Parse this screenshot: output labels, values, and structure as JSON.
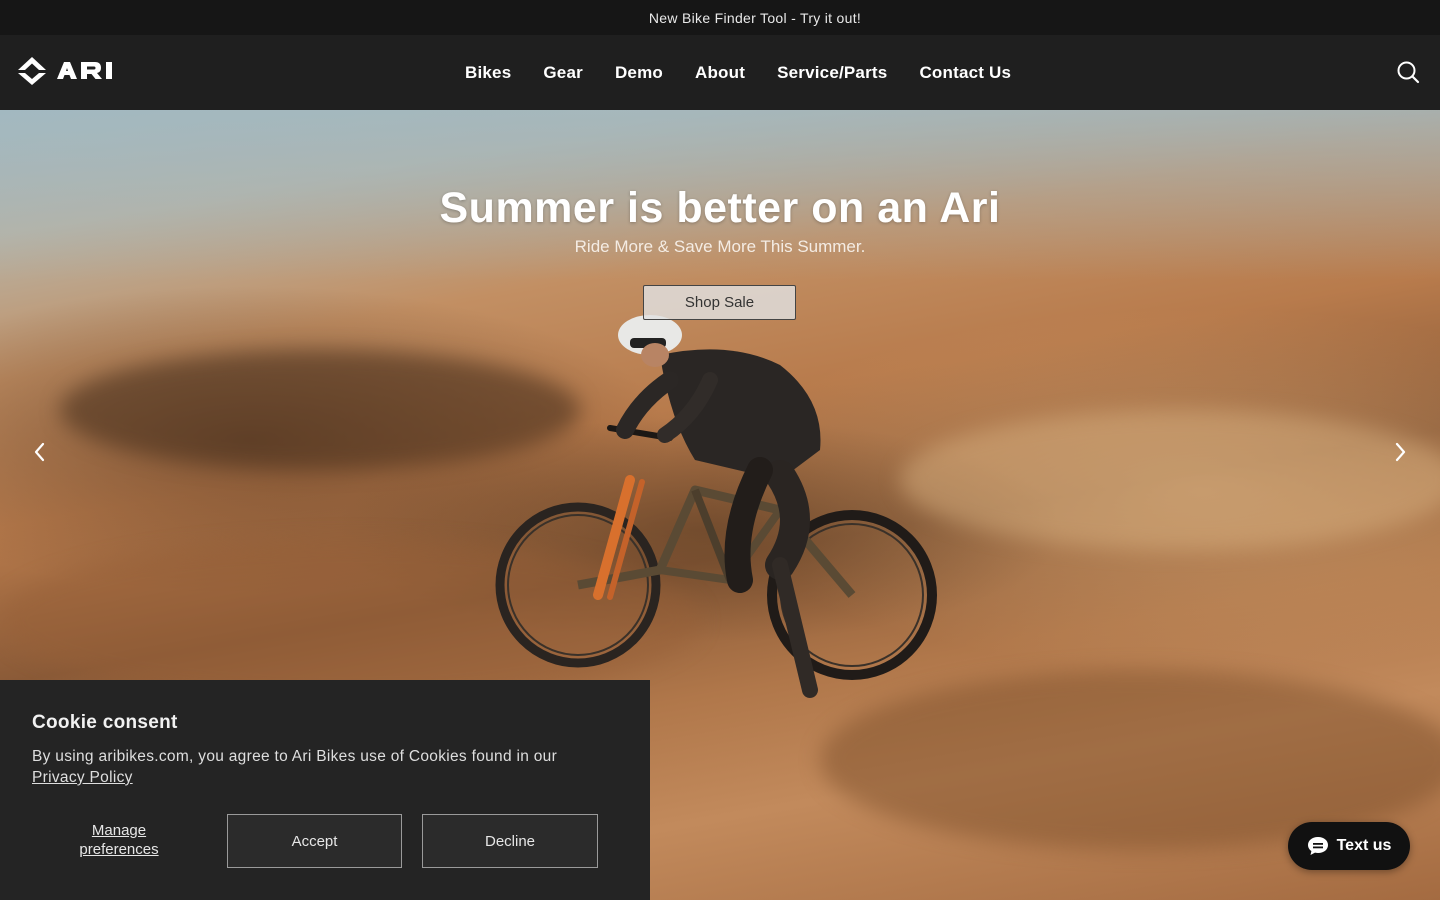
{
  "announcement": {
    "text": "New Bike Finder Tool - Try it out!"
  },
  "header": {
    "logo_text": "ARI",
    "nav": [
      {
        "label": "Bikes"
      },
      {
        "label": "Gear"
      },
      {
        "label": "Demo"
      },
      {
        "label": "About"
      },
      {
        "label": "Service/Parts"
      },
      {
        "label": "Contact Us"
      }
    ],
    "search_icon": "search-icon"
  },
  "hero": {
    "title": "Summer is better on an Ari",
    "subtitle": "Ride More & Save More This Summer.",
    "cta_label": "Shop Sale",
    "prev_icon": "chevron-left-icon",
    "next_icon": "chevron-right-icon"
  },
  "cookie": {
    "title": "Cookie consent",
    "body": "By using aribikes.com, you agree to Ari Bikes use of Cookies found in our",
    "link_label": "Privacy Policy",
    "manage_label": "Manage preferences",
    "accept_label": "Accept",
    "decline_label": "Decline"
  },
  "chat": {
    "label": "Text us",
    "icon": "chat-bubble-icon"
  },
  "colors": {
    "header_bg": "#1f1f1f",
    "announce_bg": "#161616",
    "cookie_bg": "#242424",
    "chat_bg": "#111111"
  }
}
